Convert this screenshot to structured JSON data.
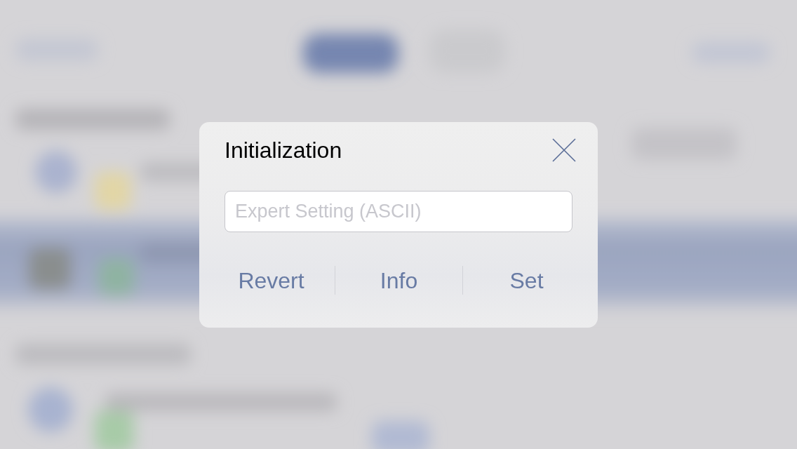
{
  "dialog": {
    "title": "Initialization",
    "input": {
      "placeholder": "Expert Setting (ASCII)"
    },
    "buttons": [
      "Revert",
      "Info",
      "Set"
    ]
  }
}
